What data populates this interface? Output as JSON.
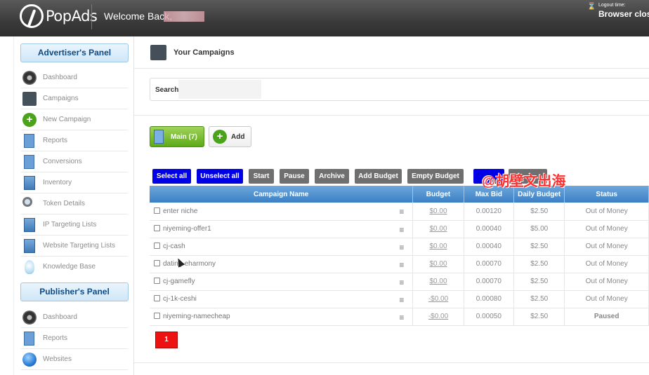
{
  "header": {
    "logo_text": "PopAds",
    "welcome_text": "Welcome Back,",
    "logout_label": "Logout time:",
    "logout_value": "Browser clos"
  },
  "sidebar": {
    "advertiser_title": "Advertiser's Panel",
    "advertiser_items": [
      {
        "label": "Dashboard",
        "icon": "dashboard-icon"
      },
      {
        "label": "Campaigns",
        "icon": "folder-icon"
      },
      {
        "label": "New Campaign",
        "icon": "plus-icon"
      },
      {
        "label": "Reports",
        "icon": "report-icon"
      },
      {
        "label": "Conversions",
        "icon": "conversions-icon"
      },
      {
        "label": "Inventory",
        "icon": "inventory-icon"
      },
      {
        "label": "Token Details",
        "icon": "magnifier-icon"
      },
      {
        "label": "IP Targeting Lists",
        "icon": "list-icon"
      },
      {
        "label": "Website Targeting Lists",
        "icon": "list-icon"
      },
      {
        "label": "Knowledge Base",
        "icon": "lightbulb-icon"
      }
    ],
    "publisher_title": "Publisher's Panel",
    "publisher_items": [
      {
        "label": "Dashboard",
        "icon": "dashboard-icon"
      },
      {
        "label": "Reports",
        "icon": "report-icon"
      },
      {
        "label": "Websites",
        "icon": "globe-icon"
      }
    ]
  },
  "main": {
    "title": "Your Campaigns",
    "search_label": "Search:",
    "search_value": "",
    "tab_main_label": "Main (7)",
    "add_label": "Add",
    "actions": [
      "Select all",
      "Unselect all",
      "Start",
      "Pause",
      "Archive",
      "Add Budget",
      "Empty Budget"
    ],
    "columns": [
      "Campaign Name",
      "Budget",
      "Max Bid",
      "Daily Budget",
      "Status"
    ],
    "rows": [
      {
        "name": "enter niche",
        "budget": "$0.00",
        "max_bid": "0.00120",
        "daily_budget": "$2.50",
        "status": "Out of Money"
      },
      {
        "name": "niyeming-offer1",
        "budget": "$0.00",
        "max_bid": "0.00040",
        "daily_budget": "$5.00",
        "status": "Out of Money"
      },
      {
        "name": "cj-cash",
        "budget": "$0.00",
        "max_bid": "0.00040",
        "daily_budget": "$2.50",
        "status": "Out of Money"
      },
      {
        "name": "dating-eharmony",
        "budget": "$0.00",
        "max_bid": "0.00070",
        "daily_budget": "$2.50",
        "status": "Out of Money"
      },
      {
        "name": "cj-gamefly",
        "budget": "$0.00",
        "max_bid": "0.00070",
        "daily_budget": "$2.50",
        "status": "Out of Money"
      },
      {
        "name": "cj-1k-ceshi",
        "budget": "-$0.00",
        "max_bid": "0.00080",
        "daily_budget": "$2.50",
        "status": "Out of Money"
      },
      {
        "name": "niyeming-namecheap",
        "budget": "-$0.00",
        "max_bid": "0.00050",
        "daily_budget": "$2.50",
        "status": "Paused"
      }
    ],
    "page": "1"
  },
  "watermark": "@胡壁文出海",
  "colors": {
    "primary_blue": "#0000e6",
    "grey_button": "#6f6f6f",
    "out_of_money": "#e59a14",
    "paused": "#1a2a9a",
    "page_red": "#ee1111"
  }
}
